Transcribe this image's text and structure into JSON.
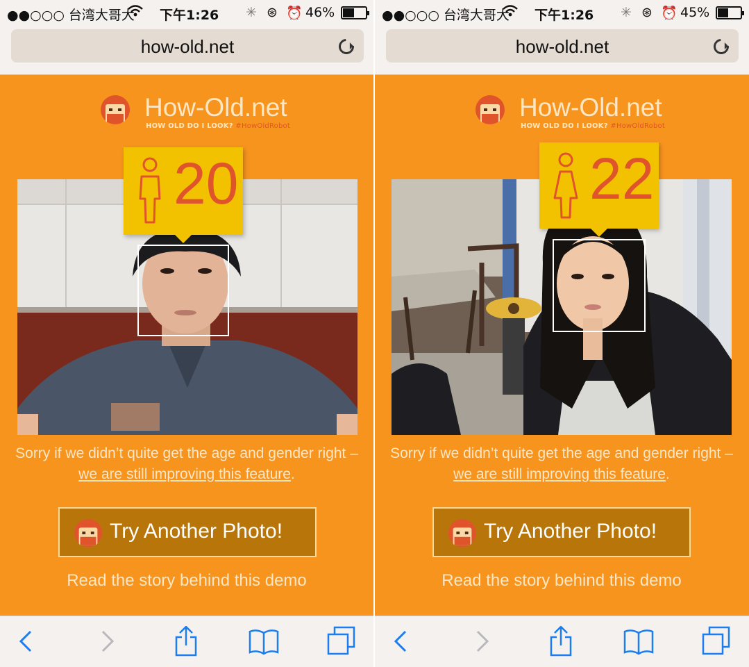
{
  "left": {
    "status": {
      "carrier": "●●○○○ 台湾大哥大",
      "time": "下午1:26",
      "battery_text": "46%",
      "battery_level": 0.46
    },
    "url": "how-old.net",
    "logo": {
      "name": "How-Old.net",
      "tagline": "HOW OLD DO I LOOK?",
      "hashtag": "#HowOldRobot"
    },
    "result": {
      "age": "20",
      "gender": "male"
    },
    "message": {
      "text": "Sorry if we didn’t quite get the age and gender right – ",
      "link": "we are still improving this feature",
      "end": "."
    },
    "button_label": "Try Another Photo!",
    "story_link": "Read the story behind this demo"
  },
  "right": {
    "status": {
      "carrier": "●●○○○ 台湾大哥大",
      "time": "下午1:26",
      "battery_text": "45%",
      "battery_level": 0.45
    },
    "url": "how-old.net",
    "logo": {
      "name": "How-Old.net",
      "tagline": "HOW OLD DO I LOOK?",
      "hashtag": "#HowOldRobot"
    },
    "result": {
      "age": "22",
      "gender": "female"
    },
    "message": {
      "text": "Sorry if we didn’t quite get the age and gender right – ",
      "link": "we are still improving this feature",
      "end": "."
    },
    "button_label": "Try Another Photo!",
    "story_link": "Read the story behind this demo"
  },
  "icons": {
    "back": "chevron-left-icon",
    "forward": "chevron-right-icon",
    "share": "share-icon",
    "bookmarks": "book-icon",
    "tabs": "tabs-icon",
    "reload": "reload-icon"
  },
  "colors": {
    "page_orange": "#f7941e",
    "age_box_yellow": "#f2c200",
    "age_text": "#e0542b",
    "button_brown": "#b8760a",
    "ios_blue": "#1a7df0"
  }
}
